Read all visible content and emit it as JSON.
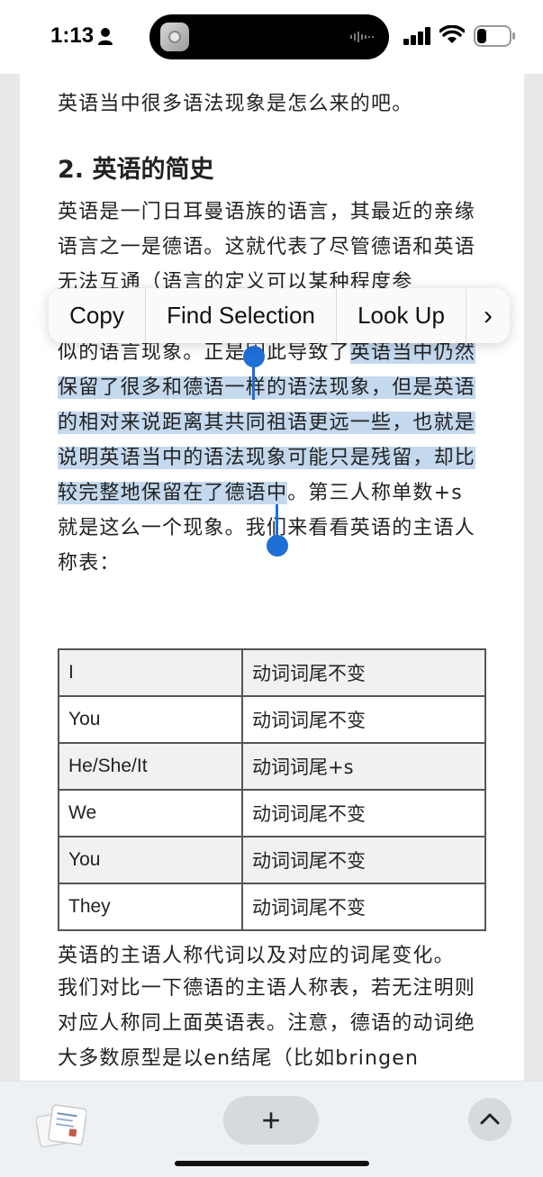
{
  "status_bar": {
    "time": "1:13"
  },
  "context_menu": {
    "items": [
      "Copy",
      "Find Selection",
      "Look Up"
    ],
    "more_glyph": "›"
  },
  "article": {
    "top_partial_line": "英语当中很多语法现象是怎么来的吧。",
    "heading": "2. 英语的简史",
    "para1_before_selection": "英语是一门日耳曼语族的语言，其最近的亲缘语言之一是德语。这就代表了尽管德语和英语无法互通（语言的定义可以某种程度参考……），但是会或多或少在其中找到大量类似的语言现象。正是因此导致了",
    "para1_selected": "英语当中仍然保留了很多和德语一样的语法现象，但是英语的相对来说距离其共同祖语更远一些，也就是说明英语当中的语法现象可能只是残留，却比较完整地保留在了德语中",
    "para1_after_selection": "。第三人称单数+s就是这么一个现象。我们来看看英语的主语人称表：",
    "table": {
      "rows": [
        [
          "I",
          "动词词尾不变"
        ],
        [
          "You",
          "动词词尾不变"
        ],
        [
          "He/She/It",
          "动词词尾+s"
        ],
        [
          "We",
          "动词词尾不变"
        ],
        [
          "You",
          "动词词尾不变"
        ],
        [
          "They",
          "动词词尾不变"
        ]
      ]
    },
    "caption": "英语的主语人称代词以及对应的词尾变化。",
    "para2": "我们对比一下德语的主语人称表，若无注明则对应人称同上面英语表。注意，德语的动词绝大多数原型是以en结尾（比如bringen"
  },
  "bottom_bar": {
    "plus_label": "+",
    "up_glyph": "chevron-up-icon"
  },
  "colors": {
    "selection": "#c4d8ee",
    "handle": "#1f6fd6"
  }
}
